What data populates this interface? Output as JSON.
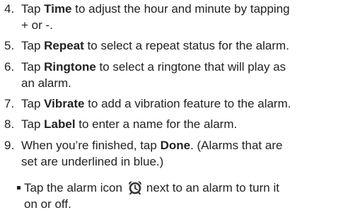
{
  "steps": [
    {
      "number": "4.",
      "pre": "Tap ",
      "keyword": "Time",
      "post": " to adjust the hour and minute by tapping",
      "line2": "+ or -."
    },
    {
      "number": "5.",
      "pre": "Tap ",
      "keyword": "Repeat",
      "post": " to select a repeat status for the alarm."
    },
    {
      "number": "6.",
      "pre": "Tap ",
      "keyword": "Ringtone",
      "post": " to select a ringtone that will play as",
      "line2": "an alarm."
    },
    {
      "number": "7.",
      "pre": "Tap ",
      "keyword": "Vibrate",
      "post": " to add a vibration feature to the alarm."
    },
    {
      "number": "8.",
      "pre": "Tap ",
      "keyword": "Label",
      "post": " to enter a name for the alarm."
    },
    {
      "number": "9.",
      "pre": "When you’re finished, tap ",
      "keyword": "Done",
      "post": ". (Alarms that are",
      "line2": "set are underlined in blue.)"
    }
  ],
  "bullet": {
    "pre": "Tap the alarm icon",
    "icon": "alarm-clock-icon",
    "post": "next to an alarm to turn it",
    "line2": "on or off."
  }
}
